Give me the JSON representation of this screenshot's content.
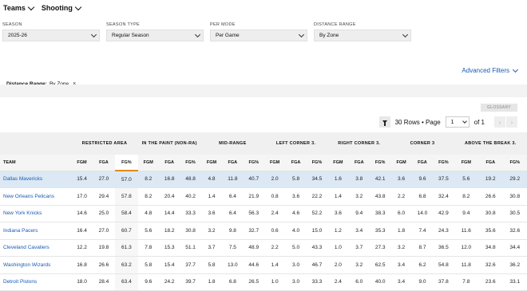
{
  "nav": {
    "items": [
      {
        "label": "Teams"
      },
      {
        "label": "Shooting"
      }
    ]
  },
  "filters": {
    "season": {
      "label": "SEASON",
      "value": "2025-26"
    },
    "season_type": {
      "label": "SEASON TYPE",
      "value": "Regular Season"
    },
    "per_mode": {
      "label": "PER MODE",
      "value": "Per Game"
    },
    "distance_range": {
      "label": "DISTANCE RANGE",
      "value": "By Zone"
    },
    "advanced_label": "Advanced Filters",
    "active_filter": {
      "name": "Distance Range:",
      "value": "By Zone",
      "remove": "×"
    }
  },
  "pager": {
    "glossary_label": "GLOSSARY",
    "rows_text": "30 Rows • Page",
    "page_value": "1",
    "of_text": "of 1",
    "prev": "‹",
    "next": "›"
  },
  "table": {
    "team_header": "TEAM",
    "groups": [
      "RESTRICTED AREA",
      "IN THE PAINT (NON-RA)",
      "MID-RANGE",
      "LEFT CORNER 3.",
      "RIGHT CORNER 3.",
      "CORNER 3",
      "ABOVE THE BREAK 3."
    ],
    "subheaders": [
      "FGM",
      "FGA",
      "FG%"
    ],
    "sorted_column": "Restricted Area FG%",
    "highlight_color": "#dce8f4",
    "sort_accent_color": "#e08a1b",
    "rows": [
      {
        "team": "Dallas Mavericks",
        "values": [
          "15.4",
          "27.0",
          "57.0",
          "8.2",
          "16.8",
          "48.8",
          "4.8",
          "11.8",
          "40.7",
          "2.0",
          "5.8",
          "34.5",
          "1.6",
          "3.8",
          "42.1",
          "3.6",
          "9.6",
          "37.5",
          "5.6",
          "19.2",
          "29.2"
        ]
      },
      {
        "team": "New Orleans Pelicans",
        "values": [
          "17.0",
          "29.4",
          "57.8",
          "8.2",
          "20.4",
          "40.2",
          "1.4",
          "6.4",
          "21.9",
          "0.8",
          "3.6",
          "22.2",
          "1.4",
          "3.2",
          "43.8",
          "2.2",
          "6.8",
          "32.4",
          "8.2",
          "26.6",
          "30.8"
        ]
      },
      {
        "team": "New York Knicks",
        "values": [
          "14.6",
          "25.0",
          "58.4",
          "4.8",
          "14.4",
          "33.3",
          "3.6",
          "6.4",
          "56.3",
          "2.4",
          "4.6",
          "52.2",
          "3.6",
          "9.4",
          "38.3",
          "6.0",
          "14.0",
          "42.9",
          "9.4",
          "30.8",
          "30.5"
        ]
      },
      {
        "team": "Indiana Pacers",
        "values": [
          "16.4",
          "27.0",
          "60.7",
          "5.6",
          "18.2",
          "30.8",
          "3.2",
          "9.8",
          "32.7",
          "0.6",
          "4.0",
          "15.0",
          "1.2",
          "3.4",
          "35.3",
          "1.8",
          "7.4",
          "24.3",
          "11.6",
          "35.6",
          "32.6"
        ]
      },
      {
        "team": "Cleveland Cavaliers",
        "values": [
          "12.2",
          "19.8",
          "61.3",
          "7.8",
          "15.3",
          "51.1",
          "3.7",
          "7.5",
          "48.9",
          "2.2",
          "5.0",
          "43.3",
          "1.0",
          "3.7",
          "27.3",
          "3.2",
          "8.7",
          "36.5",
          "12.0",
          "34.8",
          "34.4"
        ]
      },
      {
        "team": "Washington Wizards",
        "values": [
          "16.8",
          "26.6",
          "63.2",
          "5.8",
          "15.4",
          "37.7",
          "5.8",
          "13.0",
          "44.6",
          "1.4",
          "3.0",
          "46.7",
          "2.0",
          "3.2",
          "62.5",
          "3.4",
          "6.2",
          "54.8",
          "11.8",
          "32.6",
          "36.2"
        ]
      },
      {
        "team": "Detroit Pistons",
        "values": [
          "18.0",
          "28.4",
          "63.4",
          "9.6",
          "24.2",
          "39.7",
          "1.8",
          "6.8",
          "26.5",
          "1.0",
          "3.0",
          "33.3",
          "2.4",
          "6.0",
          "40.0",
          "3.4",
          "9.0",
          "37.8",
          "7.8",
          "23.6",
          "33.1"
        ]
      }
    ]
  }
}
